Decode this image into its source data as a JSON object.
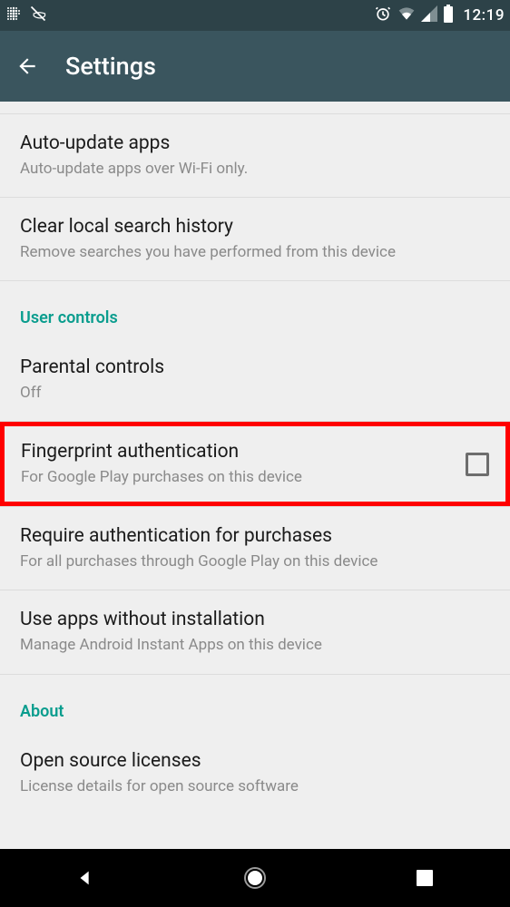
{
  "status": {
    "time": "12:19"
  },
  "appbar": {
    "title": "Settings"
  },
  "rows": {
    "auto_update": {
      "title": "Auto-update apps",
      "subtitle": "Auto-update apps over Wi-Fi only."
    },
    "clear_history": {
      "title": "Clear local search history",
      "subtitle": "Remove searches you have performed from this device"
    },
    "parental": {
      "title": "Parental controls",
      "subtitle": "Off"
    },
    "fingerprint": {
      "title": "Fingerprint authentication",
      "subtitle": "For Google Play purchases on this device",
      "checked": false
    },
    "require_auth": {
      "title": "Require authentication for purchases",
      "subtitle": "For all purchases through Google Play on this device"
    },
    "instant_apps": {
      "title": "Use apps without installation",
      "subtitle": "Manage Android Instant Apps on this device"
    },
    "licenses": {
      "title": "Open source licenses",
      "subtitle": "License details for open source software"
    }
  },
  "sections": {
    "user_controls": "User controls",
    "about": "About"
  }
}
